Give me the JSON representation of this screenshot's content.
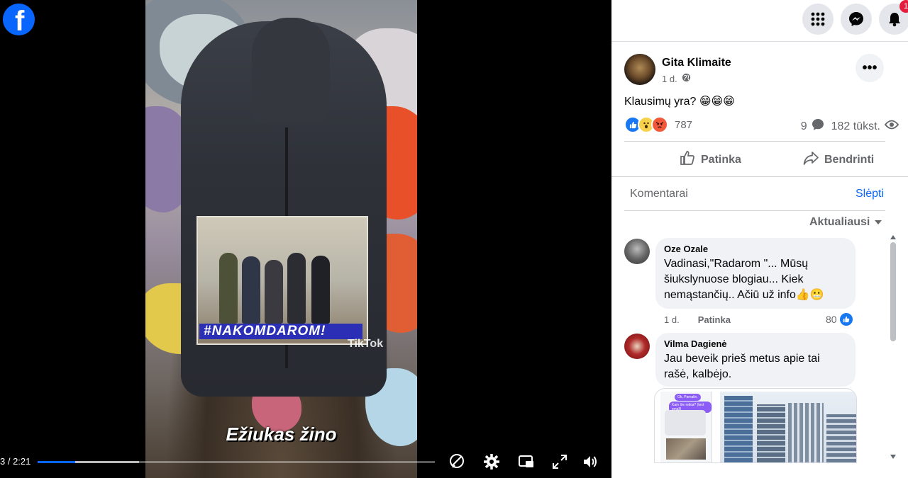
{
  "brand": {
    "logo_icon": "facebook-logo-icon",
    "color": "#0866ff"
  },
  "video": {
    "overlay": {
      "inset_banner": "#NAKOMDAROM!",
      "watermark": "TikTok",
      "caption": "Ežiukas žino"
    },
    "player": {
      "time": "3 / 2:21",
      "progress_fraction": 0.095,
      "buffered_fraction": 0.255,
      "controls": [
        {
          "name": "captions-off-icon"
        },
        {
          "name": "settings-gear-icon"
        },
        {
          "name": "picture-in-picture-icon"
        },
        {
          "name": "fullscreen-icon"
        },
        {
          "name": "volume-icon"
        }
      ]
    }
  },
  "topbar": {
    "buttons": [
      "menu-grid-icon",
      "messenger-icon",
      "notifications-bell-icon"
    ],
    "notification_badge": "1"
  },
  "post": {
    "author": "Gita Klimaite",
    "age": "1 d.",
    "privacy_icon": "globe-icon",
    "text": "Klausimų yra? 😁😁😁",
    "reactions": {
      "icons": [
        "like",
        "wow",
        "angry"
      ],
      "count": "787"
    },
    "comments_count": "9",
    "views": "182 tūkst.",
    "actions": {
      "like": "Patinka",
      "share": "Bendrinti"
    }
  },
  "comments_section": {
    "title": "Komentarai",
    "hide": "Slėpti",
    "sort": "Aktualiausi",
    "comments": [
      {
        "name": "Oze Ozale",
        "text": "Vadinasi,\"Radarom \"... Mūsų šiukslynuose blogiau... Kiek nemąstančių.. Ačiū už info👍😬",
        "age": "1 d.",
        "like_label": "Patinka",
        "likes": "80"
      },
      {
        "name": "Vilma Dagienė",
        "text": "Jau beveik prieš metus apie tai rašė, kalbėjo.",
        "attachment_chat": [
          "Ok, Pamalin.",
          "Kam šie reikia? (text small)"
        ]
      }
    ]
  },
  "colors": {
    "accent": "#0866ff",
    "badge": "#e41e3f",
    "bubble": "#f0f2f5",
    "muted": "#65676b"
  }
}
